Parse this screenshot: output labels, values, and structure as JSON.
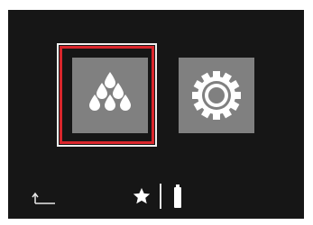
{
  "screen": {
    "background_color": "#161616"
  },
  "tiles": [
    {
      "name": "water-mode",
      "icon": "water-drops-icon",
      "color": "#808080",
      "selected": true
    },
    {
      "name": "settings",
      "icon": "gear-icon",
      "color": "#808080",
      "selected": false
    }
  ],
  "selection": {
    "outer_color": "#f0f0f0",
    "inner_color": "#d9262c"
  },
  "status_bar": {
    "icons": [
      "back-arrow-icon",
      "star-icon",
      "divider",
      "battery-icon"
    ]
  }
}
